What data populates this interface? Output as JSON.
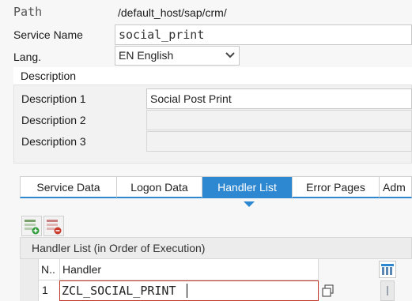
{
  "header": {
    "path_label": "Path",
    "path_value": "/default_host/sap/crm/",
    "service_label": "Service Name",
    "service_value": "social_print",
    "lang_label": "Lang.",
    "lang_value": "EN English"
  },
  "description": {
    "title": "Description",
    "rows": [
      {
        "label": "Description 1",
        "value": "Social Post Print"
      },
      {
        "label": "Description 2",
        "value": ""
      },
      {
        "label": "Description 3",
        "value": ""
      }
    ]
  },
  "tabs": [
    {
      "label": "Service Data"
    },
    {
      "label": "Logon Data"
    },
    {
      "label": "Handler List"
    },
    {
      "label": "Error Pages"
    },
    {
      "label": "Adm"
    }
  ],
  "handler_table": {
    "title": "Handler List (in Order of Execution)",
    "col_no": "N..",
    "col_handler": "Handler",
    "rows": [
      {
        "no": "1",
        "handler": "ZCL_SOCIAL_PRINT"
      }
    ]
  },
  "colors": {
    "accent": "#2e87d1",
    "focus": "#c0392b"
  }
}
